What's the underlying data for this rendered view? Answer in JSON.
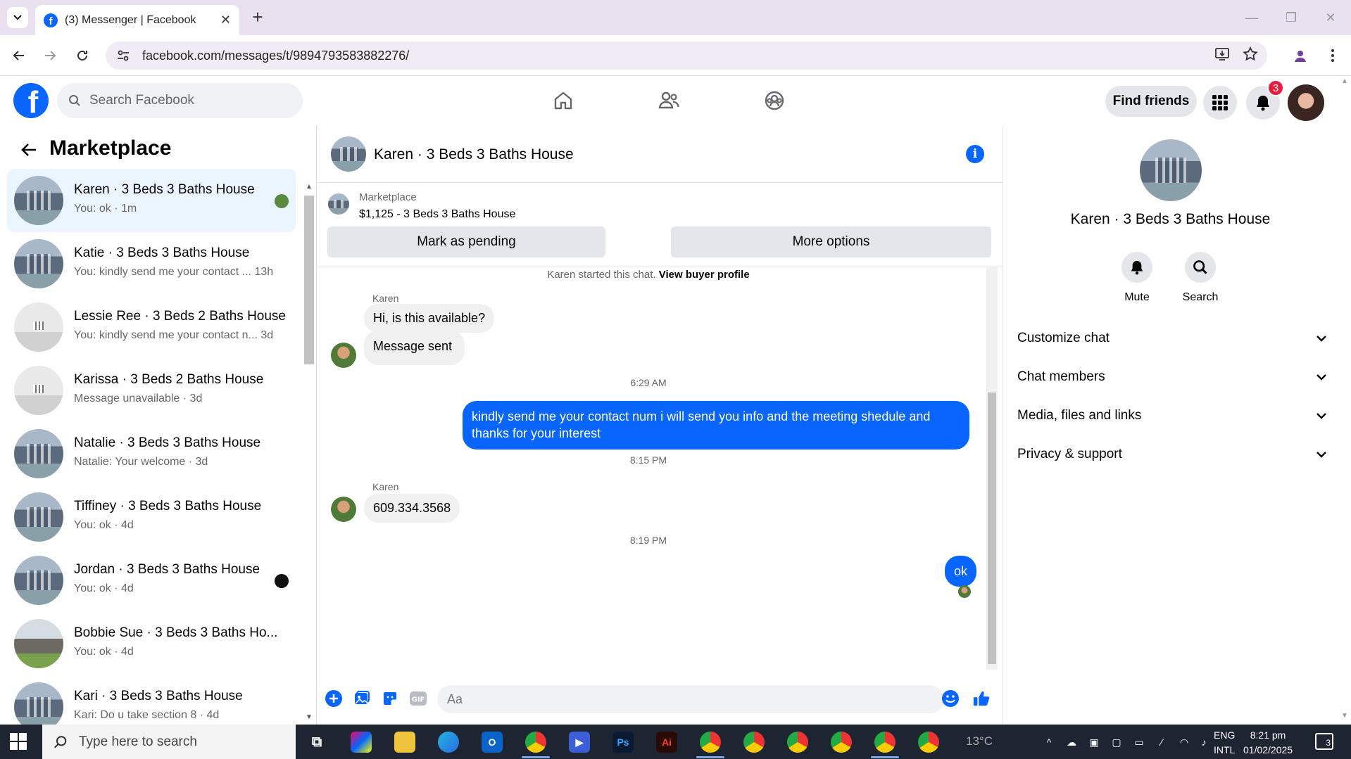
{
  "browser": {
    "tab_title": "(3) Messenger | Facebook",
    "url": "facebook.com/messages/t/9894793583882276/"
  },
  "fb_header": {
    "search_placeholder": "Search Facebook",
    "find_friends": "Find friends",
    "notification_count": "3"
  },
  "sidebar": {
    "title": "Marketplace",
    "chats": [
      {
        "name": "Karen · 3 Beds 3 Baths House",
        "preview": "You: ok · 1m",
        "thumb": "house",
        "dot": "#5a8a3e",
        "active": true
      },
      {
        "name": "Katie · 3 Beds 3 Baths House",
        "preview": "You: kindly send me your contact ... 13h",
        "thumb": "house",
        "dot": "",
        "active": false
      },
      {
        "name": "Lessie Ree · 3 Beds 2 Baths House",
        "preview": "You: kindly send me your contact n... 3d",
        "thumb": "interior",
        "dot": "",
        "active": false
      },
      {
        "name": "Karissa · 3 Beds 2 Baths House",
        "preview": "Message unavailable · 3d",
        "thumb": "interior",
        "dot": "",
        "active": false
      },
      {
        "name": "Natalie · 3 Beds 3 Baths House",
        "preview": "Natalie: Your welcome · 3d",
        "thumb": "house",
        "dot": "",
        "active": false
      },
      {
        "name": "Tiffiney · 3 Beds 3 Baths House",
        "preview": "You: ok · 4d",
        "thumb": "house",
        "dot": "",
        "active": false
      },
      {
        "name": "Jordan · 3 Beds 3 Baths House",
        "preview": "You: ok · 4d",
        "thumb": "house",
        "dot": "#111111",
        "active": false
      },
      {
        "name": "Bobbie Sue · 3 Beds 3 Baths Ho...",
        "preview": "You: ok · 4d",
        "thumb": "house-green",
        "dot": "",
        "active": false
      },
      {
        "name": "Kari · 3 Beds 3 Baths House",
        "preview": "Kari: Do u take section 8 · 4d",
        "thumb": "house",
        "dot": "",
        "active": false
      }
    ]
  },
  "conversation": {
    "title": "Karen · 3 Beds 3 Baths House",
    "listing_label": "Marketplace",
    "listing_price": "$1,125 - 3 Beds 3 Baths House",
    "mark_pending": "Mark as pending",
    "more_options": "More options",
    "started_text": "Karen started this chat.",
    "view_buyer_profile": "View buyer profile",
    "sender_name_1": "Karen",
    "msg_in_1": "Hi, is this available?",
    "msg_in_2": "Message sent",
    "time_1": "6:29 AM",
    "msg_out_1": "kindly send me your contact num i will send you info and the meeting shedule and thanks for your interest",
    "time_2": "8:15 PM",
    "sender_name_2": "Karen",
    "msg_in_3": "609.334.3568",
    "time_3": "8:19 PM",
    "msg_out_2": "ok",
    "input_placeholder": "Aa"
  },
  "info_panel": {
    "name": "Karen · 3 Beds 3 Baths House",
    "mute": "Mute",
    "search": "Search",
    "sections": [
      "Customize chat",
      "Chat members",
      "Media, files and links",
      "Privacy & support"
    ]
  },
  "taskbar": {
    "search_placeholder": "Type here to search",
    "weather": "13°C",
    "lang_1": "ENG",
    "lang_2": "INTL",
    "time": "8:21 pm",
    "date": "01/02/2025",
    "notif_count": "3"
  }
}
